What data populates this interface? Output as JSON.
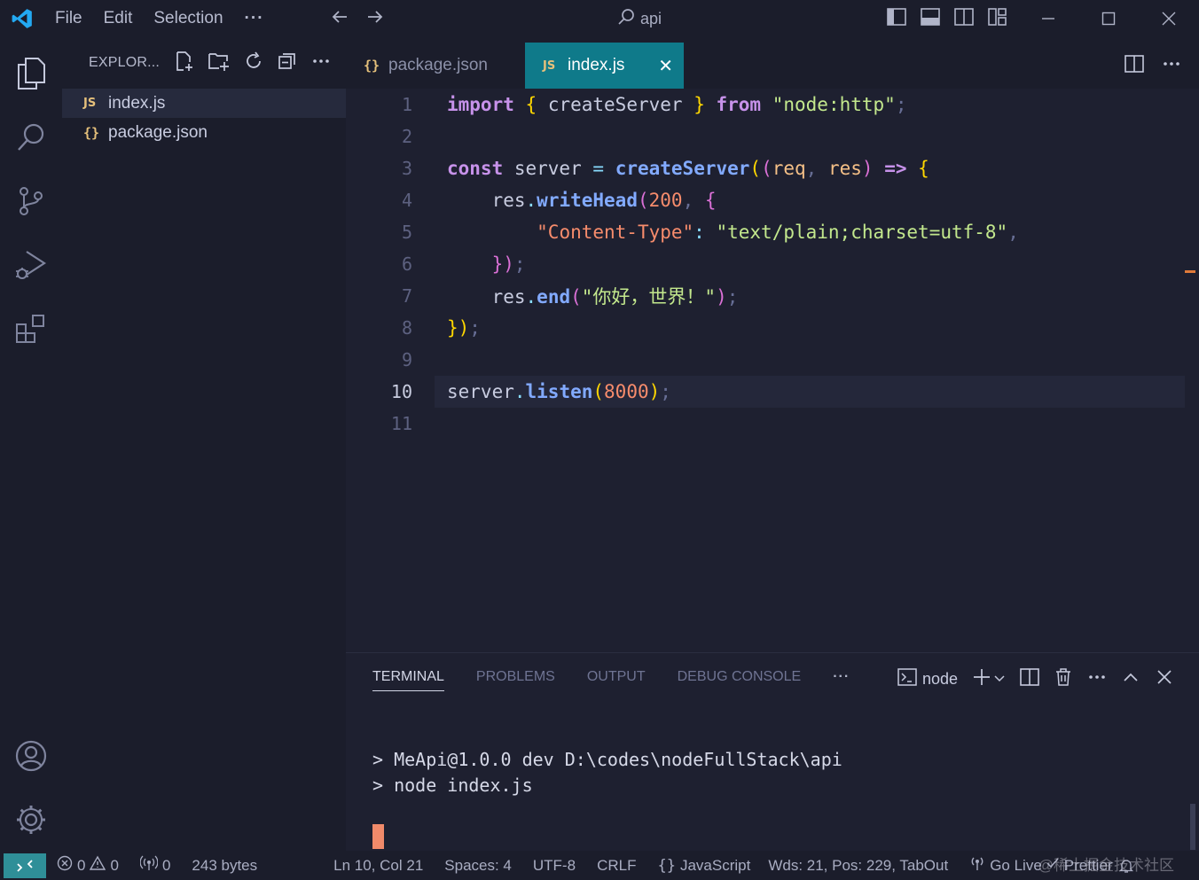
{
  "titlebar": {
    "menu": [
      "File",
      "Edit",
      "Selection",
      "···"
    ],
    "search_text": "api"
  },
  "sidebar": {
    "title": "EXPLOR...",
    "files": [
      {
        "name": "index.js",
        "icon": "JS"
      },
      {
        "name": "package.json",
        "icon": "{}"
      }
    ]
  },
  "tabs": [
    {
      "label": "package.json",
      "icon": "{}"
    },
    {
      "label": "index.js",
      "icon": "JS",
      "close": "✕"
    }
  ],
  "editor": {
    "current_line": 10,
    "line_numbers": [
      "1",
      "2",
      "3",
      "4",
      "5",
      "6",
      "7",
      "8",
      "9",
      "10",
      "11"
    ]
  },
  "panel": {
    "tabs": [
      "TERMINAL",
      "PROBLEMS",
      "OUTPUT",
      "DEBUG CONSOLE",
      "···"
    ],
    "shell": "node",
    "terminal_lines": [
      "> MeApi@1.0.0 dev D:\\codes\\nodeFullStack\\api",
      "> node index.js"
    ]
  },
  "statusbar": {
    "errors": "0",
    "warnings": "0",
    "ports": "0",
    "file_size": "243 bytes",
    "position": "Ln 10, Col 21",
    "spaces": "Spaces: 4",
    "encoding": "UTF-8",
    "eol": "CRLF",
    "language": "JavaScript",
    "words": "Wds: 21, Pos: 229, TabOut",
    "golive": "Go Live",
    "prettier": "Prettier",
    "watermark": "@稀土掘金技术社区"
  },
  "colors": {
    "accent_tab": "#0f7a8a",
    "remote": "#2f8f98",
    "cursor": "#f08a6a",
    "logo": "#23a9f2"
  }
}
